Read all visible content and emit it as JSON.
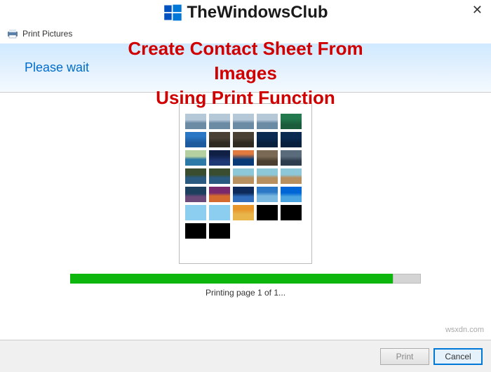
{
  "brand": {
    "name": "TheWindowsClub"
  },
  "window": {
    "title": "Print Pictures",
    "close": "✕"
  },
  "overlay": {
    "line1": "Create Contact Sheet From Images",
    "line2": "Using Print Function"
  },
  "status": {
    "please_wait": "Please wait"
  },
  "progress": {
    "text": "Printing page 1 of 1...",
    "percent": 92
  },
  "footer": {
    "print_label": "Print",
    "cancel_label": "Cancel"
  },
  "watermark": "wsxdn.com"
}
